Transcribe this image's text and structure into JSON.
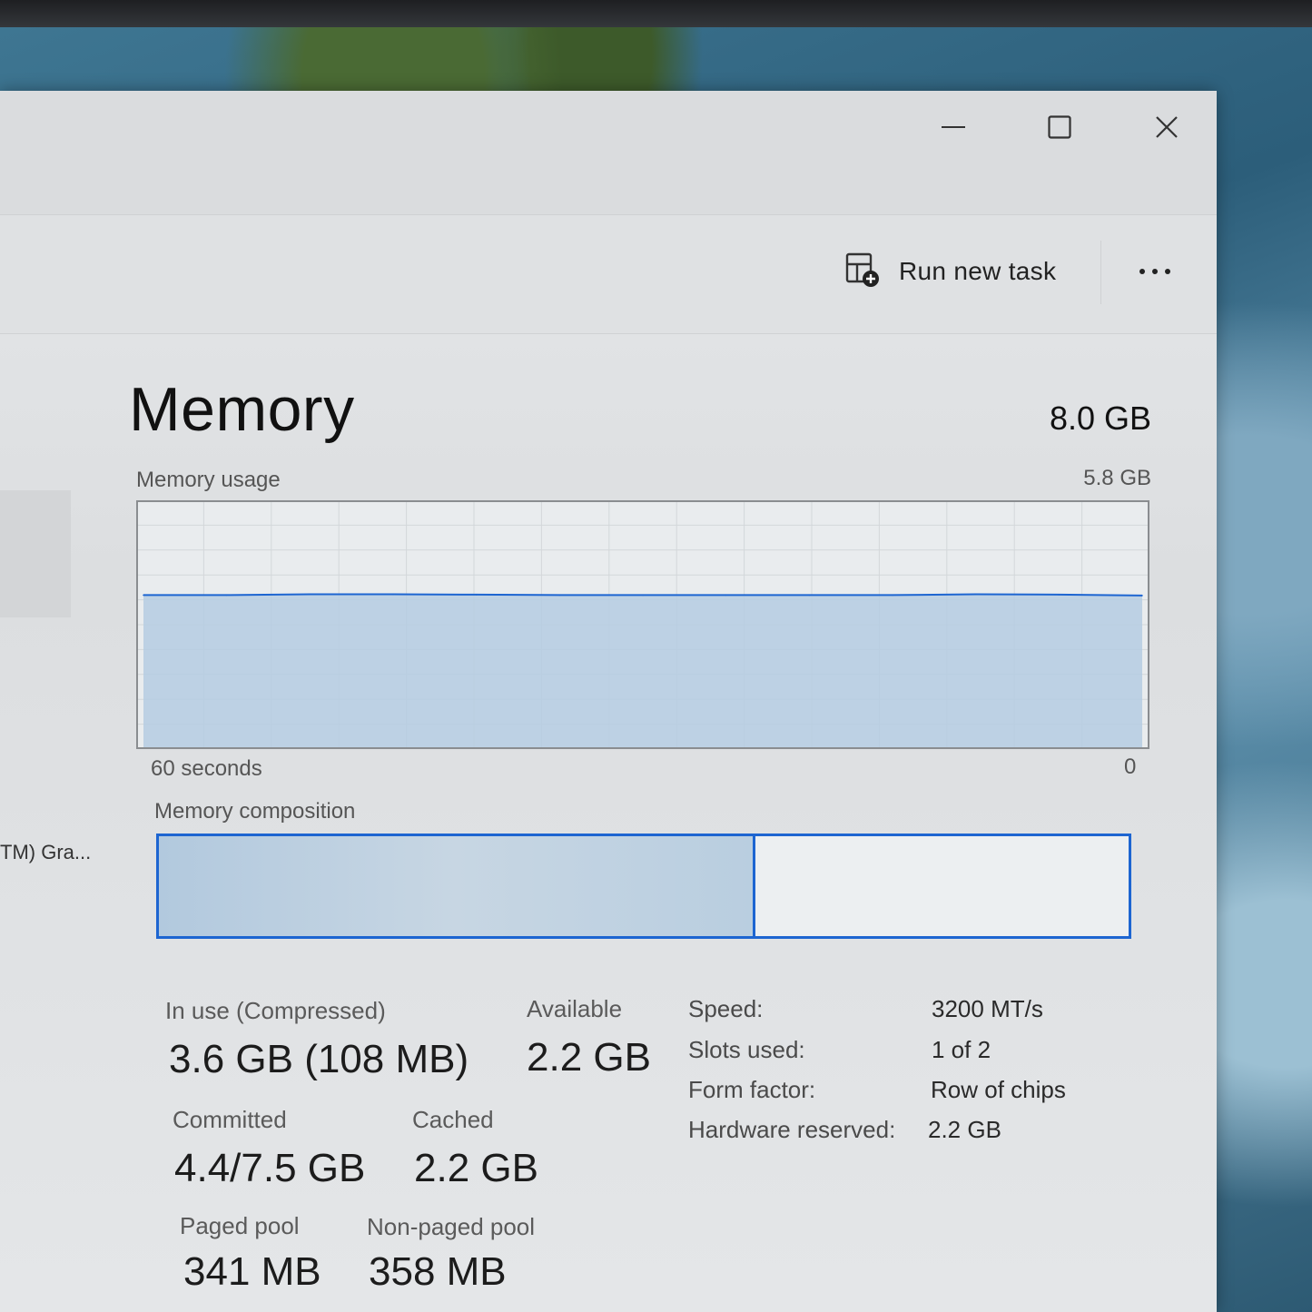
{
  "toolbar": {
    "run_new_task_label": "Run new task",
    "run_new_task_icon": "run-task-icon",
    "more_icon": "more-icon"
  },
  "caption": {
    "minimize_icon": "minimize-icon",
    "maximize_icon": "maximize-icon",
    "close_icon": "close-icon"
  },
  "sidebar": {
    "partial_item_label": "TM) Gra..."
  },
  "memory": {
    "title": "Memory",
    "total": "8.0 GB",
    "usage_label": "Memory usage",
    "usage_max": "5.8 GB",
    "time_start_label": "60 seconds",
    "time_end_label": "0",
    "composition_label": "Memory composition",
    "composition_in_use_fraction": 0.615
  },
  "stats": {
    "in_use_label": "In use (Compressed)",
    "in_use_value": "3.6 GB (108 MB)",
    "available_label": "Available",
    "available_value": "2.2 GB",
    "committed_label": "Committed",
    "committed_value": "4.4/7.5 GB",
    "cached_label": "Cached",
    "cached_value": "2.2 GB",
    "paged_pool_label": "Paged pool",
    "paged_pool_value": "341 MB",
    "non_paged_pool_label": "Non-paged pool",
    "non_paged_pool_value": "358 MB"
  },
  "details": {
    "speed_key": "Speed:",
    "speed_value": "3200 MT/s",
    "slots_key": "Slots used:",
    "slots_value": "1 of 2",
    "form_factor_key": "Form factor:",
    "form_factor_value": "Row of chips",
    "hw_reserved_key": "Hardware reserved:",
    "hw_reserved_value": "2.2 GB"
  },
  "colors": {
    "accent": "#1d65d1",
    "graph_fill": "#b5cce2"
  },
  "chart_data": {
    "type": "area",
    "x": [
      60,
      55,
      50,
      45,
      40,
      35,
      30,
      25,
      20,
      15,
      10,
      5,
      0
    ],
    "values": [
      3.6,
      3.6,
      3.62,
      3.62,
      3.61,
      3.6,
      3.6,
      3.6,
      3.6,
      3.6,
      3.62,
      3.61,
      3.59
    ],
    "ylim": [
      0,
      5.8
    ],
    "xlabel": "",
    "ylabel": "",
    "grid": true
  }
}
